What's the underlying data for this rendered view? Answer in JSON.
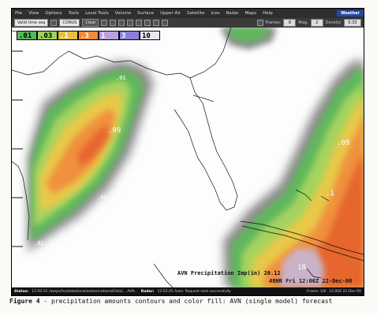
{
  "menu": {
    "items": [
      "File",
      "View",
      "Options",
      "Tools",
      "Local Tools",
      "Volume",
      "Surface",
      "Upper Air",
      "Satellite",
      "Ices",
      "Radar",
      "Maps",
      "Help"
    ],
    "brand": "Weather"
  },
  "toolbar": {
    "valid_time": "Valid time seq",
    "contour_select": "CONUS",
    "clear_label": "Clear",
    "frames_label": "Frames:",
    "frames_value": "8",
    "mag_label": "Mag:",
    "mag_value": "2",
    "density_label": "Density:",
    "density_value": "0.33"
  },
  "legend": {
    "items": [
      {
        "label": ".01",
        "color": "#59b85a"
      },
      {
        "label": ".03",
        "color": "#9bd35f"
      },
      {
        "label": ".1",
        "color": "#e3c044"
      },
      {
        "label": ".3",
        "color": "#f08a3a"
      },
      {
        "label": "1",
        "color": "#b8a0e0"
      },
      {
        "label": "3",
        "color": "#8a7fd8"
      },
      {
        "label": "10",
        "color": "#e8e8ee"
      }
    ]
  },
  "contour_labels": [
    ".01",
    ".09",
    ".01",
    ".01",
    ".01",
    ".09",
    ".1",
    ".01",
    "18"
  ],
  "product": {
    "title_line": "AVN Precipitation Imp(in) 20.12",
    "time_line": "48HR Fri 12:00Z 22-Dec-00"
  },
  "status": {
    "status_label": "Status:",
    "status_msg": "12:00:31 /awips/fxa/data/localization/nationalData/... AVN...",
    "radar_label": "Radar:",
    "radar_msg": "12:03:45 Auto: Request sent successfully",
    "frames_text": "Frame: 1/8",
    "time_text": "12:00Z 22-Dec-00"
  },
  "caption": {
    "prefix": "Figure 4",
    "text": " - precipitation amounts contours and color fill: AVN (single model) forecast"
  }
}
